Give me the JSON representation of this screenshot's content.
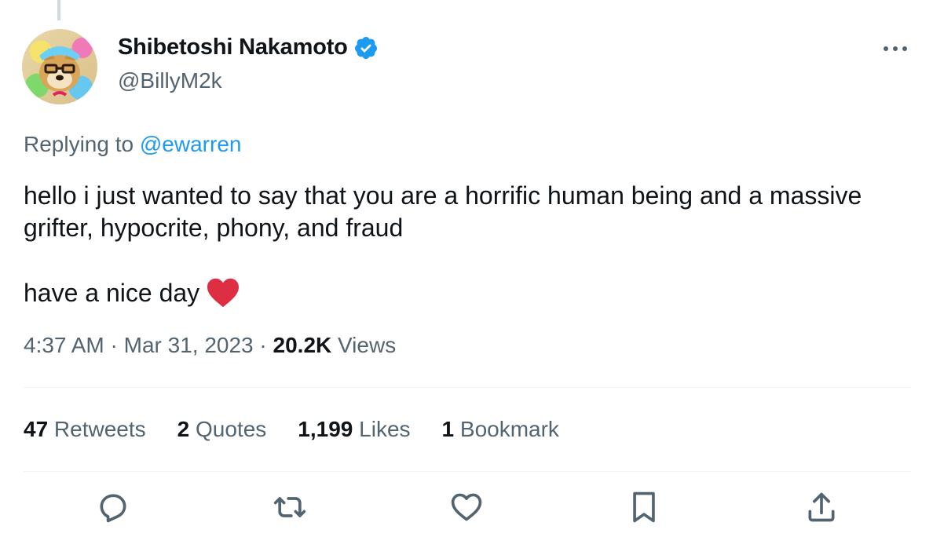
{
  "tweet": {
    "author": {
      "display_name": "Shibetoshi Nakamoto",
      "handle": "@BillyM2k",
      "verified_color": "#1d9bf0"
    },
    "replying_to_prefix": "Replying to ",
    "replying_to_handle": "@ewarren",
    "text_line1": "hello i just wanted to say that you are a horrific human being and a massive grifter, hypocrite, phony, and fraud",
    "text_line2": "have a nice day",
    "time": "4:37 AM",
    "separator": " · ",
    "date": "Mar 31, 2023",
    "views_count": "20.2K",
    "views_label": " Views",
    "stats": {
      "retweets": {
        "count": "47",
        "label": " Retweets"
      },
      "quotes": {
        "count": "2",
        "label": " Quotes"
      },
      "likes": {
        "count": "1,199",
        "label": " Likes"
      },
      "bookmarks": {
        "count": "1",
        "label": " Bookmark"
      }
    },
    "accent_color": "#1d9bf0",
    "heart_color": "#e0245e"
  },
  "icons": {
    "more": "more-dots-icon",
    "reply": "reply-icon",
    "retweet": "retweet-icon",
    "like": "like-icon",
    "bookmark": "bookmark-icon",
    "share": "share-icon"
  }
}
